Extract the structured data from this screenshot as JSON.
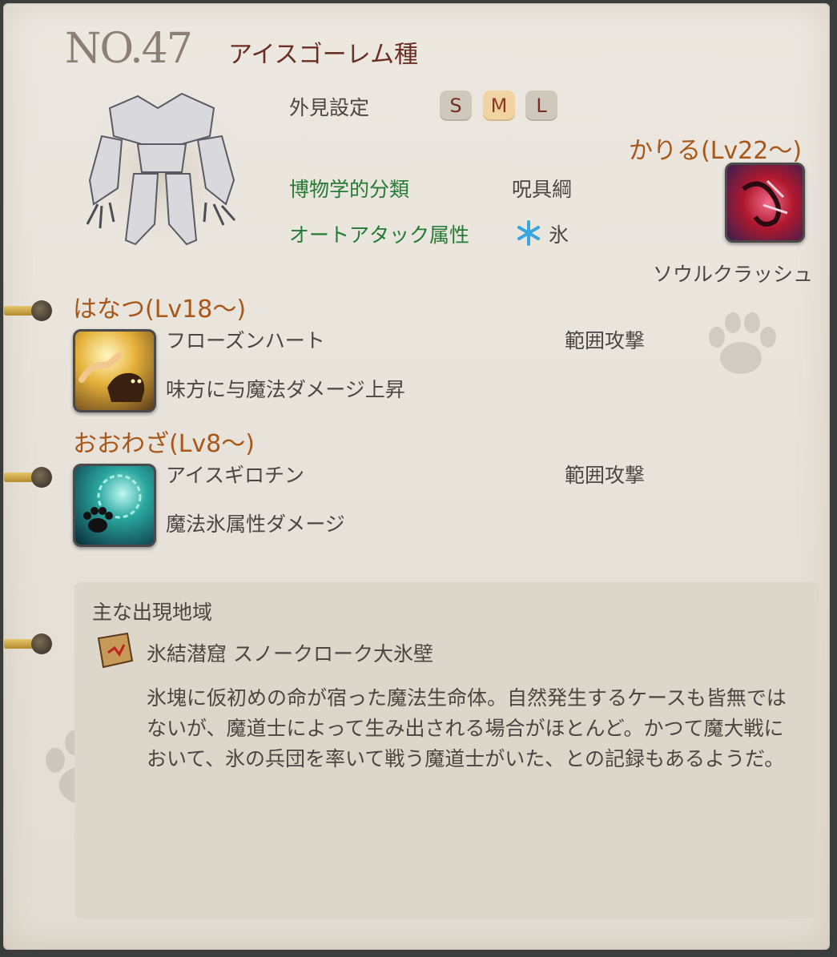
{
  "header": {
    "number": "NO.47",
    "name": "アイスゴーレム種"
  },
  "appearance": {
    "label": "外見設定",
    "sizes": [
      "S",
      "M",
      "L"
    ],
    "selected": "M"
  },
  "classification": {
    "label": "博物学的分類",
    "value": "呪具綱"
  },
  "auto_attack": {
    "label": "オートアタック属性",
    "value": "氷",
    "icon": "ice-snowflake-icon",
    "icon_color": "#3aa6e0"
  },
  "kariru": {
    "title": "かりる(Lv22～)",
    "skill_name": "ソウルクラッシュ",
    "icon": "soul-crush-icon"
  },
  "hanatsu": {
    "title": "はなつ(Lv18～)",
    "skill_name": "フローズンハート",
    "range": "範囲攻撃",
    "effect": "味方に与魔法ダメージ上昇",
    "icon": "frozen-heart-icon"
  },
  "oowaza": {
    "title": "おおわざ(Lv8～)",
    "skill_name": "アイスギロチン",
    "range": "範囲攻撃",
    "effect": "魔法氷属性ダメージ",
    "icon": "ice-guillotine-icon"
  },
  "region": {
    "heading": "主な出現地域",
    "location": "氷結潜窟 スノークローク大氷壁",
    "location_icon": "map-scroll-icon",
    "description": "氷塊に仮初めの命が宿った魔法生命体。自然発生するケースも皆無ではないが、魔道士によって生み出される場合がほとんど。かつて魔大戦において、氷の兵団を率いて戦う魔道士がいた、との記録もあるようだ。"
  },
  "colors": {
    "accent_orange": "#a8561a",
    "green": "#257a34",
    "title_red": "#6a2f22"
  }
}
